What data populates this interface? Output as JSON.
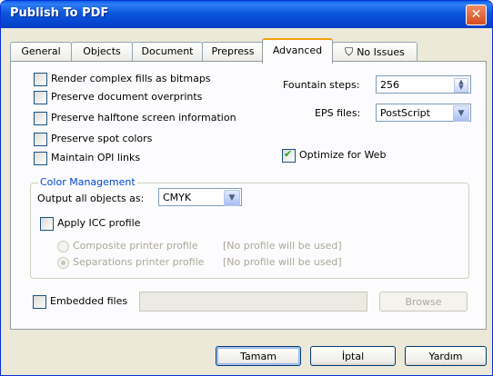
{
  "window": {
    "title": "Publish To PDF",
    "close_icon": "close-icon"
  },
  "tabs": [
    {
      "label": "General"
    },
    {
      "label": "Objects"
    },
    {
      "label": "Document"
    },
    {
      "label": "Prepress"
    },
    {
      "label": "Advanced",
      "active": true
    },
    {
      "label": "No Issues",
      "icon": "issues-icon"
    }
  ],
  "advanced": {
    "options": [
      {
        "label": "Render complex fills as bitmaps",
        "checked": false
      },
      {
        "label": "Preserve document overprints",
        "checked": false
      },
      {
        "label": "Preserve halftone screen information",
        "checked": false
      },
      {
        "label": "Preserve spot colors",
        "checked": false
      },
      {
        "label": "Maintain OPI links",
        "checked": false
      }
    ],
    "fountain_steps": {
      "label": "Fountain steps:",
      "value": "256"
    },
    "eps_files": {
      "label": "EPS files:",
      "value": "PostScript"
    },
    "optimize_web": {
      "label": "Optimize for Web",
      "checked": true
    }
  },
  "color_management": {
    "title": "Color Management",
    "output_label": "Output all objects as:",
    "output_value": "CMYK",
    "apply_icc": {
      "label": "Apply ICC profile",
      "checked": false
    },
    "composite": {
      "label": "Composite printer profile",
      "note": "[No profile will be used]",
      "selected": false
    },
    "separations": {
      "label": "Separations printer profile",
      "note": "[No profile will be used]",
      "selected": true
    }
  },
  "embedded": {
    "label": "Embedded files",
    "checked": false,
    "value": "",
    "browse_label": "Browse"
  },
  "buttons": {
    "ok": "Tamam",
    "cancel": "İptal",
    "help": "Yardım"
  },
  "colors": {
    "titlebar": "#0a5fe8",
    "active_tab_highlight": "#f2a00a",
    "group_title": "#0046d5",
    "check_mark": "#21a121"
  }
}
